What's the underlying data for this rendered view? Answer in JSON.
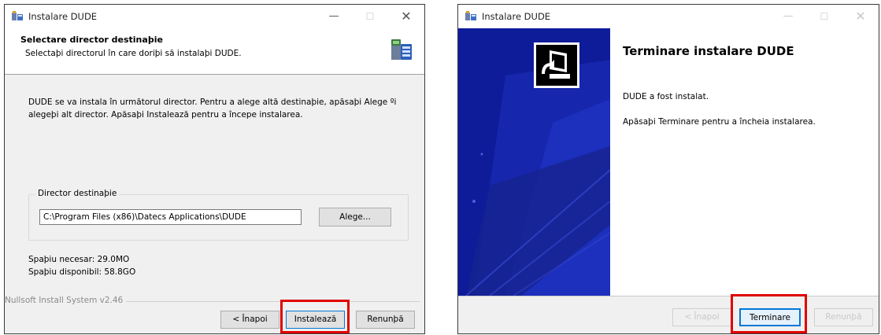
{
  "installer_left": {
    "window_title": "Instalare DUDE",
    "header": {
      "title": "Selectare director destinaþie",
      "subtitle": "Selectaþi directorul în care doriþi să instalaþi DUDE."
    },
    "description_line1": "DUDE se va instala în următorul director. Pentru a alege altă destinaþie, apăsaþi Alege ºi",
    "description_line2": "alegeþi alt director. Apăsaþi Instalează pentru a începe instalarea.",
    "destination": {
      "group_label": "Director destinaþie",
      "path_value": "C:\\Program Files (x86)\\Datecs Applications\\DUDE",
      "browse_label": "Alege..."
    },
    "space_required": "Spaþiu necesar: 29.0MO",
    "space_available": "Spaþiu disponibil: 58.8GO",
    "branding": "Nullsoft Install System v2.46",
    "buttons": {
      "back": "< Înapoi",
      "install": "Instalează",
      "cancel": "Renunþă"
    }
  },
  "installer_right": {
    "window_title": "Instalare DUDE",
    "title": "Terminare instalare DUDE",
    "line1": "DUDE a fost instalat.",
    "line2": "Apăsaþi Terminare pentru a încheia instalarea.",
    "buttons": {
      "back": "< Înapoi",
      "finish": "Terminare",
      "cancel": "Renunþă"
    }
  },
  "window_controls": {
    "minimize": "—",
    "maximize": "☐",
    "close": "✕"
  },
  "colors": {
    "highlight": "#e00000",
    "banner_blue": "#0e1c9a",
    "focus_blue": "#0078d7"
  }
}
